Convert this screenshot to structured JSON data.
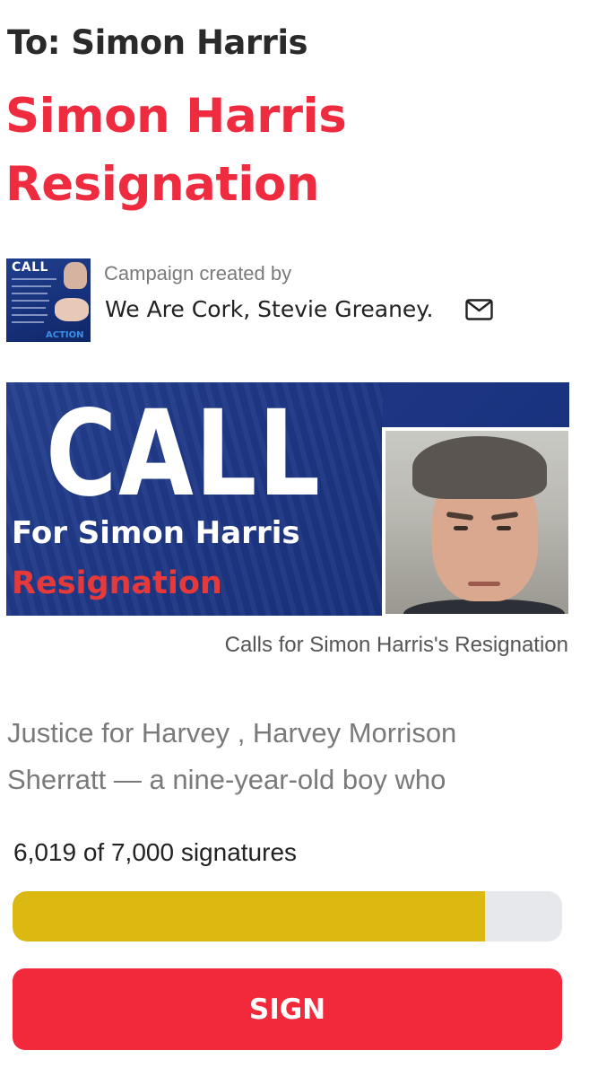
{
  "header": {
    "to_line": "To: Simon Harris",
    "title": "Simon Harris Resignation"
  },
  "creator": {
    "label": "Campaign created by",
    "name": "We Are Cork, Stevie Greaney.",
    "thumbnail_text_top": "CALL",
    "thumbnail_text_bottom": "ACTION",
    "contact_icon": "mail-icon"
  },
  "banner": {
    "headline": "CALL",
    "subline": "For Simon Harris",
    "highlight": "Resignation",
    "caption": "Calls for Simon Harris's Resignation",
    "colors": {
      "background": "#1d3583",
      "headline": "#ffffff",
      "highlight": "#e63a3a"
    }
  },
  "description": {
    "text": "Justice for Harvey , Harvey Morrison Sherratt — a nine-year-old boy who"
  },
  "signatures": {
    "summary": "6,019 of 7,000 signatures",
    "current": 6019,
    "goal": 7000,
    "progress_fraction": 0.86
  },
  "actions": {
    "sign_label": "SIGN"
  },
  "colors": {
    "title": "#ef2b3f",
    "progress_fill": "#dbb911",
    "progress_track": "#e6e8ec",
    "sign_button": "#f2293b"
  }
}
